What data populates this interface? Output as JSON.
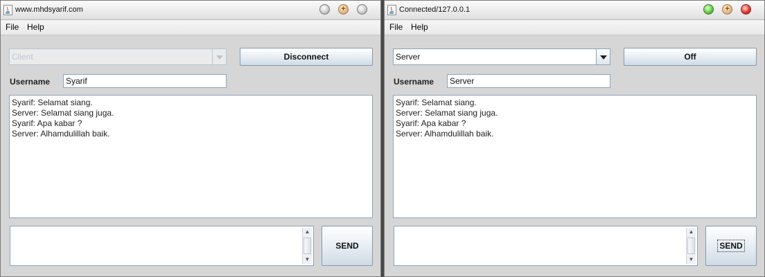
{
  "client_window": {
    "title": "www.mhdsyarif.com",
    "menu": [
      "File",
      "Help"
    ],
    "mode_select": "Client",
    "connect_button": "Disconnect",
    "username_label": "Username",
    "username_value": "Syarif",
    "messages": [
      "Syarif: Selamat siang.",
      "Server: Selamat siang juga.",
      "Syarif: Apa kabar ?",
      "Server: Alhamdulillah baik."
    ],
    "message_input": "",
    "send_button": "SEND"
  },
  "server_window": {
    "title": "Connected/127.0.0.1",
    "menu": [
      "File",
      "Help"
    ],
    "mode_select": "Server",
    "connect_button": "Off",
    "username_label": "Username",
    "username_value": "Server",
    "messages": [
      "Syarif: Selamat siang.",
      "Server: Selamat siang juga.",
      "Syarif: Apa kabar ?",
      "Server: Alhamdulillah baik."
    ],
    "message_input": "",
    "send_button": "SEND"
  },
  "colors": {
    "window_bg": "#d6d6d6",
    "button_border": "#8399ad",
    "field_border": "#8ea3b8",
    "disabled_text": "#b9c6d3"
  },
  "icons": {
    "title_app": "java-cup-icon",
    "left_controls": [
      "minimize-icon",
      "maximize-icon",
      "close-icon"
    ],
    "right_controls": [
      "minimize-icon",
      "maximize-icon",
      "close-icon"
    ],
    "combo_arrow": "chevron-down-icon",
    "scroll_up": "arrow-up-icon",
    "scroll_down": "arrow-down-icon"
  }
}
